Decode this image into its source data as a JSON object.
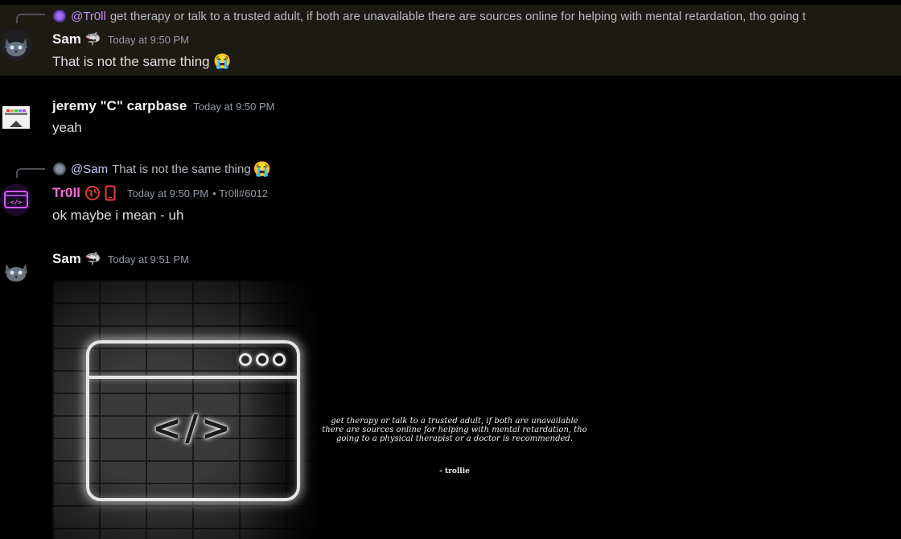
{
  "messages": [
    {
      "reply": {
        "mention": "@Tr0ll",
        "text": "get therapy or talk to a trusted adult, if both are unavailable there are sources online for helping with mental retardation, tho going t"
      },
      "author": "Sam",
      "badge_emoji": "🦈",
      "timestamp": "Today at 9:50 PM",
      "content": "That is not the same thing",
      "content_emoji": "😭"
    },
    {
      "author": "jeremy \"C\" carpbase",
      "timestamp": "Today at 9:50 PM",
      "content": "yeah"
    },
    {
      "reply": {
        "mention": "@Sam",
        "text": "That is not the same thing",
        "emoji": "😭"
      },
      "author": "Tr0ll",
      "badge_icons": [
        "globe-icon",
        "mobile-icon"
      ],
      "timestamp": "Today at 9:50 PM",
      "tag": "• Tr0ll#6012",
      "content": "ok maybe i mean  - uh"
    },
    {
      "author": "Sam",
      "badge_emoji": "🦈",
      "timestamp": "Today at 9:51 PM",
      "attachment": {
        "code_glyph": "</>",
        "quote": "get therapy or talk to a trusted adult, if both are unavailable there are sources online for helping with mental retardation, tho going to a physical therapist or a doctor is recommended.",
        "quote_author": "- trollie"
      }
    }
  ],
  "colors": {
    "background": "#000000",
    "highlight": "#1d1a12",
    "username_default": "#f2f3f5",
    "username_troll": "#ff6bd6",
    "timestamp": "#949ba4",
    "badge_red": "#e03a3a"
  }
}
